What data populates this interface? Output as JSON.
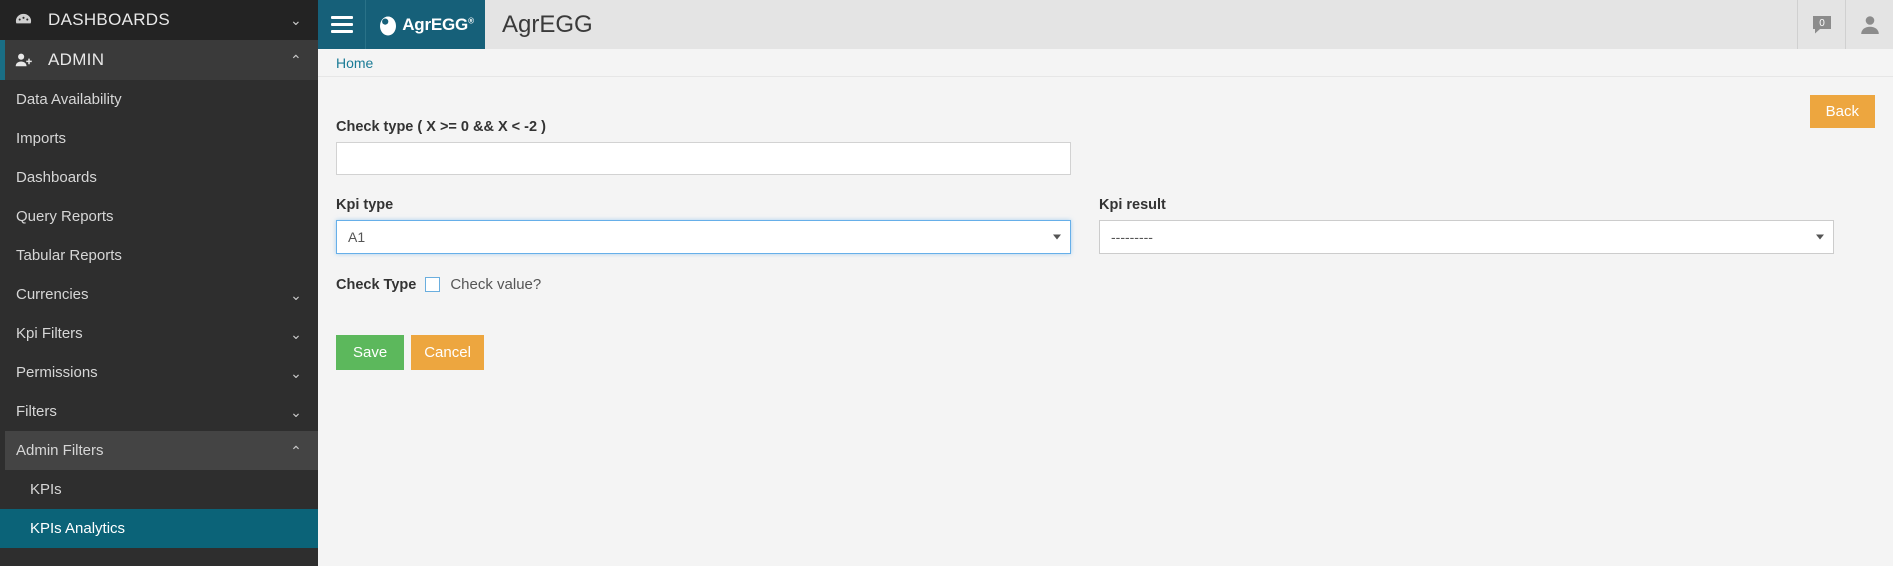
{
  "sidebar": {
    "sections": [
      {
        "id": "dashboards",
        "label": "DASHBOARDS",
        "icon": "dashboard-icon",
        "chevron": "⌄",
        "expanded": false
      },
      {
        "id": "admin",
        "label": "ADMIN",
        "icon": "user-add-icon",
        "chevron": "⌃",
        "expanded": true
      }
    ],
    "items": [
      {
        "label": "Data Availability",
        "chevron": ""
      },
      {
        "label": "Imports",
        "chevron": ""
      },
      {
        "label": "Dashboards",
        "chevron": ""
      },
      {
        "label": "Query Reports",
        "chevron": ""
      },
      {
        "label": "Tabular Reports",
        "chevron": ""
      },
      {
        "label": "Currencies",
        "chevron": "⌄"
      },
      {
        "label": "Kpi Filters",
        "chevron": "⌄"
      },
      {
        "label": "Permissions",
        "chevron": "⌄"
      },
      {
        "label": "Filters",
        "chevron": "⌄"
      },
      {
        "label": "Admin Filters",
        "chevron": "⌃",
        "open": true
      }
    ],
    "subitems": [
      {
        "label": "KPIs",
        "active": false
      },
      {
        "label": "KPIs Analytics",
        "active": true
      }
    ],
    "colors": {
      "background": "#2e2e2e",
      "active": "#0b6378",
      "open": "#444444",
      "accent": "#1a6e85"
    }
  },
  "topbar": {
    "menu_toggle": "hamburger-icon",
    "brand": "AgrEGG",
    "brand_mark": "®",
    "title": "AgrEGG",
    "messages_badge": "0",
    "user_icon": "user-avatar-icon",
    "colors": {
      "teal": "#166079",
      "bar": "#e4e4e4"
    }
  },
  "breadcrumb": {
    "items": [
      "Home"
    ]
  },
  "content": {
    "back_label": "Back",
    "check_type_label": "Check type ( X >= 0 && X < -2 )",
    "check_type_value": "",
    "check_type_placeholder": "",
    "kpi_type_label": "Kpi type",
    "kpi_type_value": "A1",
    "kpi_result_label": "Kpi result",
    "kpi_result_value": "---------",
    "check_type_field_label": "Check Type",
    "check_value_label": "Check value?",
    "check_value_checked": false,
    "save_label": "Save",
    "cancel_label": "Cancel",
    "colors": {
      "save": "#5cb85c",
      "cancel": "#eda63f",
      "back": "#eda63f",
      "focus": "#66afe9"
    }
  }
}
